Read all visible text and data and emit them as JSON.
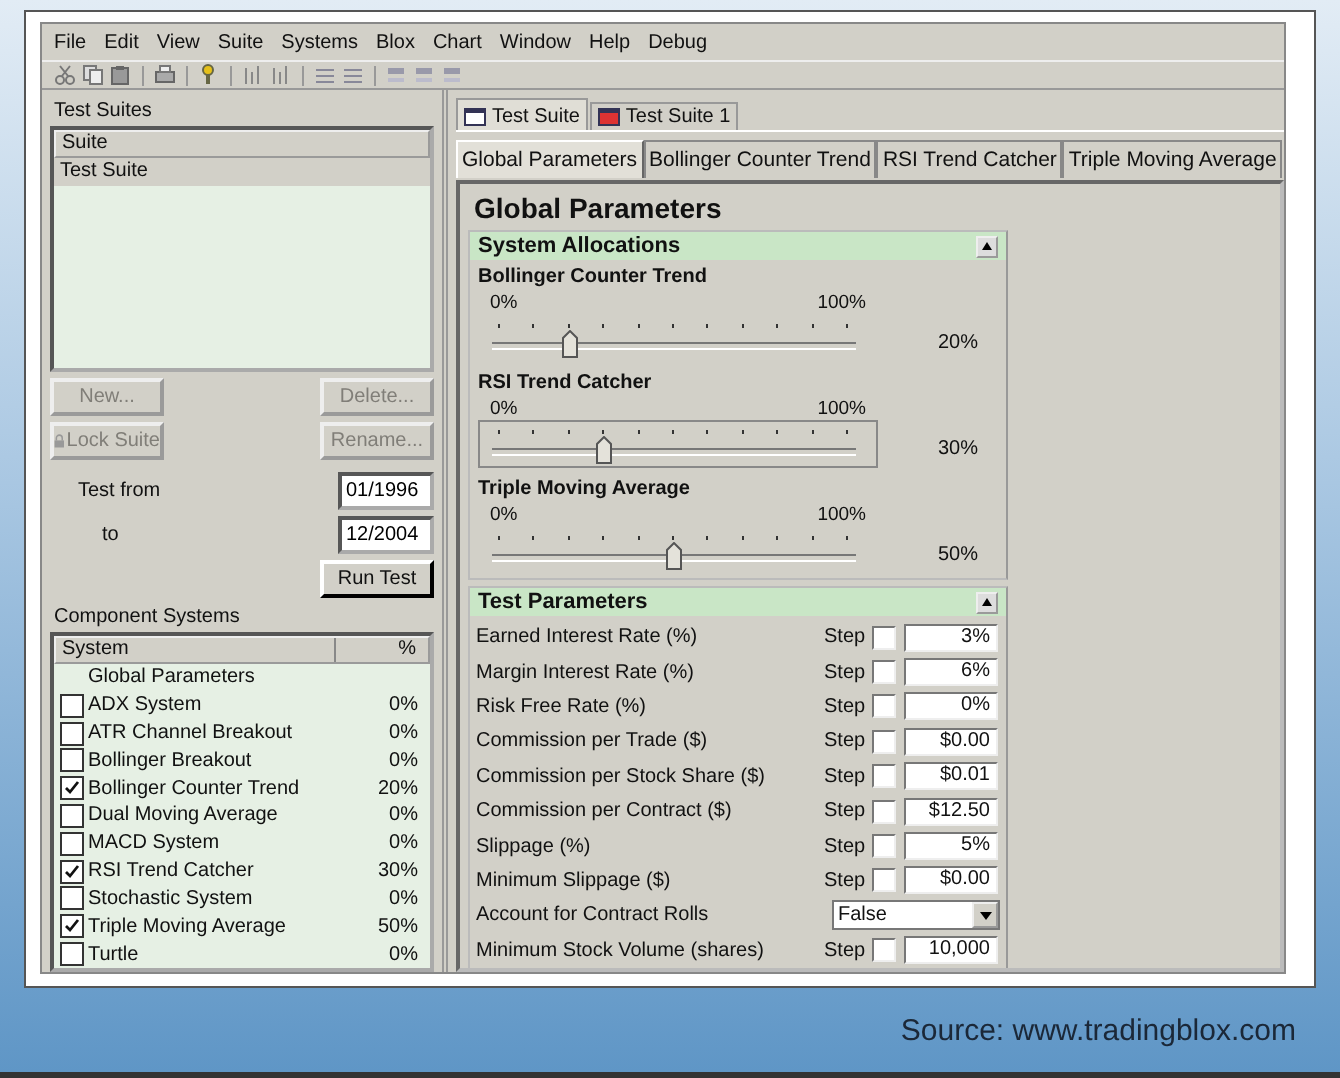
{
  "menu": [
    "File",
    "Edit",
    "View",
    "Suite",
    "Systems",
    "Blox",
    "Chart",
    "Window",
    "Help",
    "Debug"
  ],
  "test_suites": {
    "title": "Test Suites",
    "column": "Suite",
    "items": [
      {
        "label": "Test Suite",
        "selected": true
      }
    ]
  },
  "suite_buttons": [
    {
      "label": "New...",
      "disabled": true,
      "kind": "plain"
    },
    {
      "label": "Delete...",
      "disabled": true,
      "kind": "plain"
    },
    {
      "label": "Lock Suite",
      "disabled": true,
      "kind": "lock"
    },
    {
      "label": "Rename...",
      "disabled": true,
      "kind": "plain"
    }
  ],
  "test_from": {
    "label": "Test from",
    "value": "01/1996"
  },
  "test_to": {
    "label": "to",
    "value": "12/2004"
  },
  "run_button": {
    "label": "Run Test",
    "disabled": false
  },
  "components": {
    "title": "Component Systems",
    "columns": [
      "System",
      "%"
    ],
    "rows": [
      {
        "kind": "header",
        "name": "Global Parameters"
      },
      {
        "kind": "system",
        "name": "ADX System",
        "checked": false,
        "percent": "0%"
      },
      {
        "kind": "system",
        "name": "ATR Channel Breakout",
        "checked": false,
        "percent": "0%"
      },
      {
        "kind": "system",
        "name": "Bollinger Breakout",
        "checked": false,
        "percent": "0%"
      },
      {
        "kind": "system",
        "name": "Bollinger Counter Trend",
        "checked": true,
        "percent": "20%"
      },
      {
        "kind": "system",
        "name": "Dual Moving Average",
        "checked": false,
        "percent": "0%"
      },
      {
        "kind": "system",
        "name": "MACD System",
        "checked": false,
        "percent": "0%"
      },
      {
        "kind": "system",
        "name": "RSI Trend Catcher",
        "checked": true,
        "percent": "30%"
      },
      {
        "kind": "system",
        "name": "Stochastic System",
        "checked": false,
        "percent": "0%"
      },
      {
        "kind": "system",
        "name": "Triple Moving Average",
        "checked": true,
        "percent": "50%"
      },
      {
        "kind": "system",
        "name": "Turtle",
        "checked": false,
        "percent": "0%"
      }
    ]
  },
  "doc_tabs": [
    {
      "label": "Test Suite",
      "selected": true
    },
    {
      "label": "Test Suite 1",
      "selected": false
    }
  ],
  "param_tabs": [
    {
      "label": "Global Parameters",
      "selected": true
    },
    {
      "label": "Bollinger Counter Trend",
      "selected": false
    },
    {
      "label": "RSI Trend Catcher",
      "selected": false
    },
    {
      "label": "Triple Moving Average",
      "selected": false
    }
  ],
  "page_title": "Global Parameters",
  "allocations": {
    "title": "System Allocations",
    "sliders": [
      {
        "label": "Bollinger Counter Trend",
        "min_label": "0%",
        "max_label": "100%",
        "level": 0.2,
        "reading": "20%",
        "focused": false
      },
      {
        "label": "RSI Trend Catcher",
        "min_label": "0%",
        "max_label": "100%",
        "level": 0.3,
        "reading": "30%",
        "focused": true
      },
      {
        "label": "Triple Moving Average",
        "min_label": "0%",
        "max_label": "100%",
        "level": 0.5,
        "reading": "50%",
        "focused": false
      }
    ]
  },
  "test_parameters": {
    "title": "Test Parameters",
    "rows": [
      {
        "kind": "step",
        "label": "Earned Interest Rate (%)",
        "step_label": "Step",
        "step_checked": false,
        "value": "3%"
      },
      {
        "kind": "step",
        "label": "Margin Interest Rate (%)",
        "step_label": "Step",
        "step_checked": false,
        "value": "6%"
      },
      {
        "kind": "step",
        "label": "Risk Free Rate (%)",
        "step_label": "Step",
        "step_checked": false,
        "value": "0%"
      },
      {
        "kind": "step",
        "label": "Commission per Trade ($)",
        "step_label": "Step",
        "step_checked": false,
        "value": "$0.00"
      },
      {
        "kind": "step",
        "label": "Commission per Stock Share ($)",
        "step_label": "Step",
        "step_checked": false,
        "value": "$0.01"
      },
      {
        "kind": "step",
        "label": "Commission per Contract ($)",
        "step_label": "Step",
        "step_checked": false,
        "value": "$12.50"
      },
      {
        "kind": "step",
        "label": "Slippage (%)",
        "step_label": "Step",
        "step_checked": false,
        "value": "5%"
      },
      {
        "kind": "step",
        "label": "Minimum Slippage ($)",
        "step_label": "Step",
        "step_checked": false,
        "value": "$0.00"
      },
      {
        "kind": "dropdown",
        "label": "Account for Contract Rolls",
        "value": "False"
      },
      {
        "kind": "step",
        "label": "Minimum Stock Volume (shares)",
        "step_label": "Step",
        "step_checked": false,
        "value": "10,000"
      }
    ]
  },
  "caption": "Source: www.tradingblox.com"
}
